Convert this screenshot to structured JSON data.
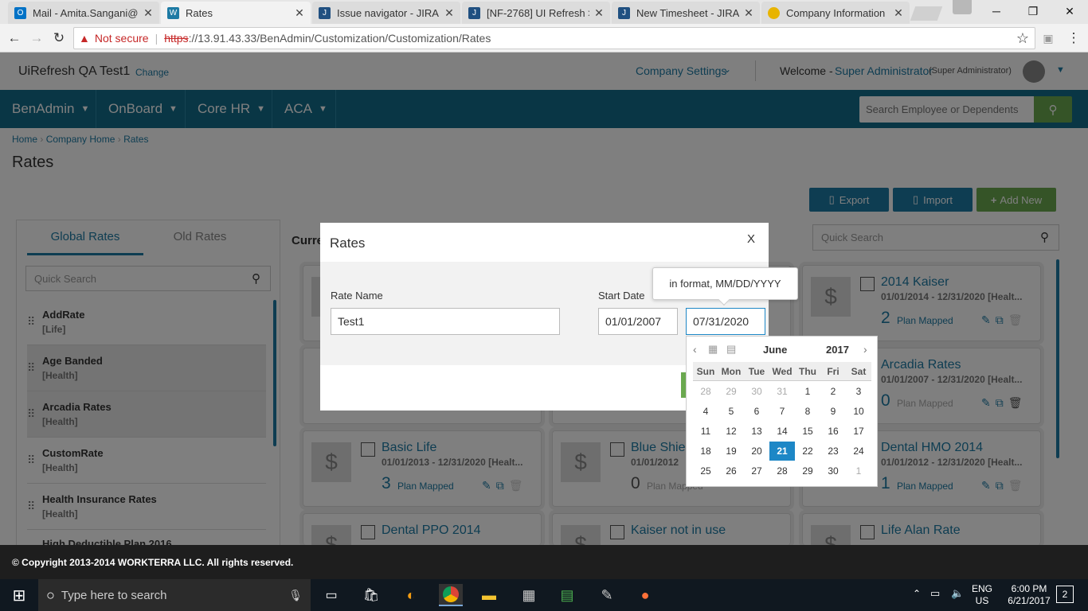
{
  "browser": {
    "tabs": [
      {
        "title": "Mail - Amita.Sangani@h",
        "icon_color": "#0072c6"
      },
      {
        "title": "Rates",
        "icon_color": "#1d7aa4"
      },
      {
        "title": "Issue navigator - JIRA",
        "icon_color": "#205081"
      },
      {
        "title": "[NF-2768] UI Refresh >",
        "icon_color": "#205081"
      },
      {
        "title": "New Timesheet - JIRA",
        "icon_color": "#205081"
      },
      {
        "title": "Company Information",
        "icon_color": "#e8b400"
      }
    ],
    "security_label": "Not secure",
    "url_scheme": "https",
    "url_rest": "://13.91.43.33/BenAdmin/Customization/Customization/Rates"
  },
  "header": {
    "company": "UiRefresh QA Test1",
    "change_link": "Change",
    "company_settings": "Company Settings",
    "welcome": "Welcome -",
    "user": "Super Administrator",
    "role": "(Super Administrator)"
  },
  "menu": {
    "items": [
      "BenAdmin",
      "OnBoard",
      "Core HR",
      "ACA"
    ],
    "search_placeholder": "Search Employee or Dependents"
  },
  "breadcrumb": [
    "Home",
    "Company Home",
    "Rates"
  ],
  "page_title": "Rates",
  "actions": {
    "export": "Export",
    "import": "Import",
    "add_new": "Add New"
  },
  "left_panel": {
    "tabs": [
      "Global Rates",
      "Old Rates"
    ],
    "search_placeholder": "Quick Search",
    "items": [
      {
        "name": "AddRate",
        "type": "[Life]"
      },
      {
        "name": "Age Banded",
        "type": "[Health]"
      },
      {
        "name": "Arcadia Rates",
        "type": "[Health]"
      },
      {
        "name": "CustomRate",
        "type": "[Health]"
      },
      {
        "name": "Health Insurance Rates",
        "type": "[Health]"
      },
      {
        "name": "High Deductible Plan 2016",
        "type": ""
      }
    ]
  },
  "main": {
    "section_label": "Curre",
    "search_placeholder": "Quick Search",
    "plan_mapped": "Plan Mapped",
    "cards": [
      {
        "name": "2014 Kaiser",
        "dates": "01/01/2014 - 12/31/2020 [Healt...",
        "count": "2"
      },
      {
        "name": "Arcadia Rates",
        "dates": "01/01/2007 - 12/31/2020 [Healt...",
        "count": "0"
      },
      {
        "name": "Basic Life",
        "dates": "01/01/2013 - 12/31/2020 [Healt...",
        "count": "3"
      },
      {
        "name": "Blue Shiel",
        "dates": "01/01/2012",
        "count": "0"
      },
      {
        "name": "Dental HMO 2014",
        "dates": "01/01/2012 - 12/31/2020 [Healt...",
        "count": "1"
      },
      {
        "name": "Dental PPO 2014",
        "dates": "",
        "count": ""
      },
      {
        "name": "Kaiser not in use",
        "dates": "",
        "count": ""
      },
      {
        "name": "Life Alan Rate",
        "dates": "",
        "count": ""
      }
    ]
  },
  "dialog": {
    "title": "Rates",
    "close": "X",
    "rate_name_label": "Rate Name",
    "rate_name_value": "Test1",
    "start_date_label": "Start Date",
    "start_date_value": "01/01/2007",
    "end_date_value": "07/31/2020",
    "tooltip": "in format, MM/DD/YYYY"
  },
  "calendar": {
    "month": "June",
    "year": "2017",
    "weekdays": [
      "Sun",
      "Mon",
      "Tue",
      "Wed",
      "Thu",
      "Fri",
      "Sat"
    ],
    "weeks": [
      [
        "28",
        "29",
        "30",
        "31",
        "1",
        "2",
        "3"
      ],
      [
        "4",
        "5",
        "6",
        "7",
        "8",
        "9",
        "10"
      ],
      [
        "11",
        "12",
        "13",
        "14",
        "15",
        "16",
        "17"
      ],
      [
        "18",
        "19",
        "20",
        "21",
        "22",
        "23",
        "24"
      ],
      [
        "25",
        "26",
        "27",
        "28",
        "29",
        "30",
        "1"
      ]
    ],
    "selected_day": "21"
  },
  "footer": "© Copyright 2013-2014 WORKTERRA LLC. All rights reserved.",
  "taskbar": {
    "search_placeholder": "Type here to search",
    "lang": "ENG",
    "region": "US",
    "time": "6:00 PM",
    "date": "6/21/2017",
    "notifications": "2"
  },
  "colors": {
    "menu_bg": "#136c8a",
    "accent": "#1d7aa4",
    "add_new": "#6aa84f",
    "calendar_selected": "#1d87c6"
  }
}
